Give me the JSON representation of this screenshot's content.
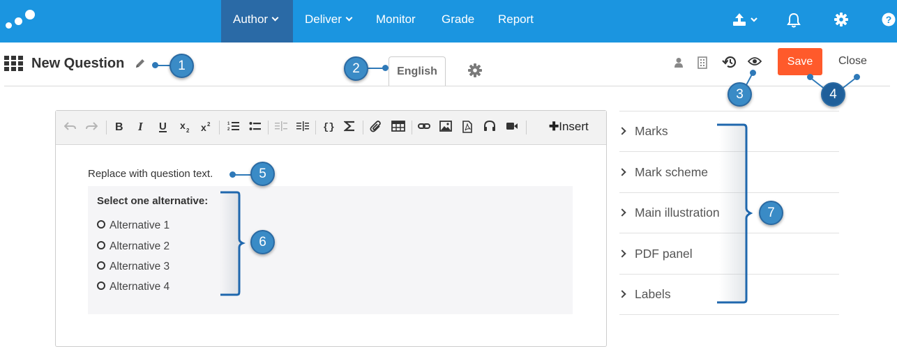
{
  "nav": {
    "items": [
      {
        "label": "Author",
        "active": true,
        "dropdown": true
      },
      {
        "label": "Deliver",
        "active": false,
        "dropdown": true
      },
      {
        "label": "Monitor",
        "active": false,
        "dropdown": false
      },
      {
        "label": "Grade",
        "active": false,
        "dropdown": false
      },
      {
        "label": "Report",
        "active": false,
        "dropdown": false
      }
    ],
    "right_icons": [
      "upload-icon",
      "bell-icon",
      "gear-icon",
      "help-icon"
    ],
    "color": "#1b95e0",
    "active_color": "#2a6aa6"
  },
  "header": {
    "title": "New Question",
    "language_tab": "English",
    "save_label": "Save",
    "close_label": "Close",
    "save_color": "#ff5a2b"
  },
  "toolbar": {
    "insert_label": "Insert"
  },
  "editor": {
    "question_text": "Replace with question text.",
    "alternatives_heading": "Select one alternative:",
    "alternatives": [
      "Alternative 1",
      "Alternative 2",
      "Alternative 3",
      "Alternative 4"
    ]
  },
  "panel": {
    "items": [
      "Marks",
      "Mark scheme",
      "Main illustration",
      "PDF panel",
      "Labels"
    ]
  },
  "annotations": [
    "1",
    "2",
    "3",
    "4",
    "5",
    "6",
    "7"
  ]
}
